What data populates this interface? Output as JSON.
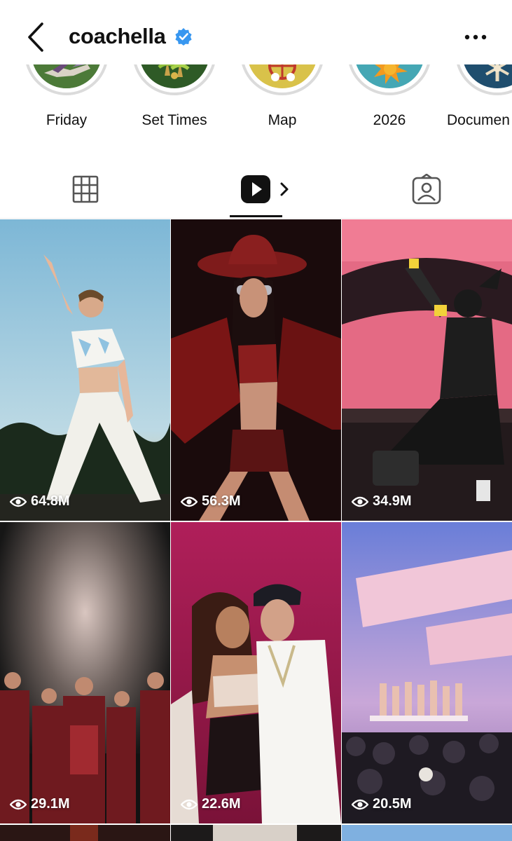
{
  "header": {
    "title": "coachella",
    "verified": true,
    "icons": [
      "back-chevron-icon",
      "verified-badge-icon",
      "more-dots-icon"
    ]
  },
  "highlights": [
    {
      "label": "Friday"
    },
    {
      "label": "Set Times"
    },
    {
      "label": "Map"
    },
    {
      "label": "2026"
    },
    {
      "label": "Documen"
    }
  ],
  "tabs": [
    {
      "name": "grid",
      "icon": "grid-icon",
      "active": false
    },
    {
      "name": "reels",
      "icon": "reels-play-icon",
      "active": true
    },
    {
      "name": "tagged",
      "icon": "tagged-user-icon",
      "active": false
    }
  ],
  "reels": [
    {
      "views": "64.8M"
    },
    {
      "views": "56.3M"
    },
    {
      "views": "34.9M"
    },
    {
      "views": "29.1M"
    },
    {
      "views": "22.6M"
    },
    {
      "views": "20.5M"
    }
  ],
  "colors": {
    "verified": "#3897f0",
    "ring": "#dbdbdb",
    "text": "#111111"
  }
}
